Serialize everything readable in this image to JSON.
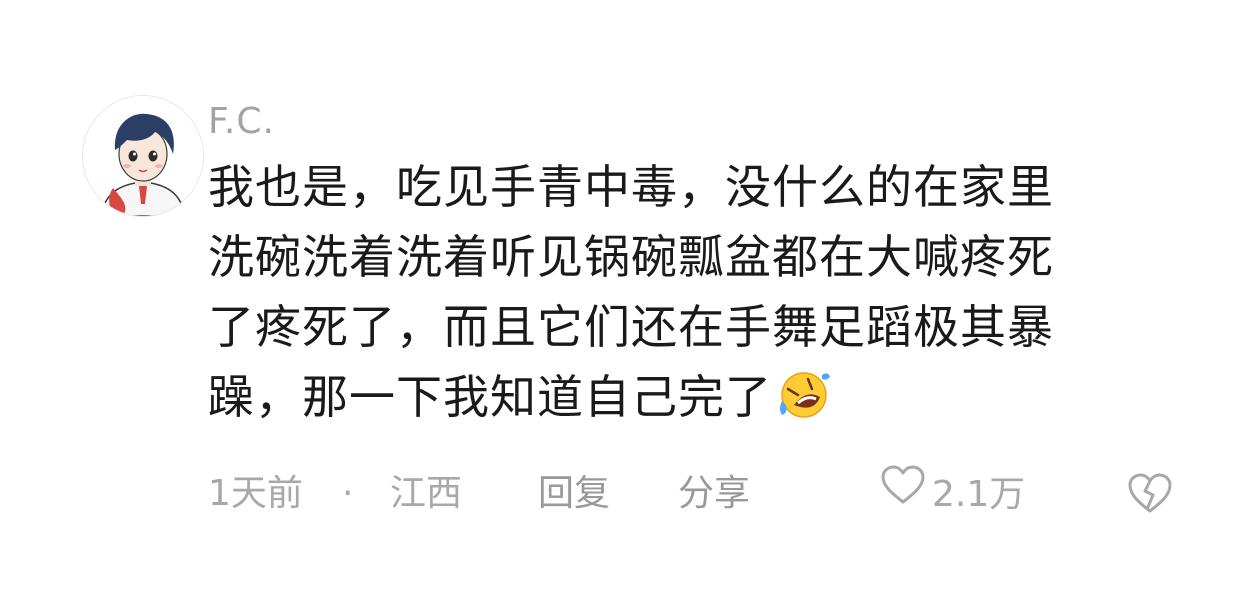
{
  "comment": {
    "username": "F.C.",
    "text_lines": [
      "我也是，吃见手青中毒，没什么的在家里",
      "洗碗洗着洗着听见锅碗瓢盆都在大喊疼死",
      "了疼死了，而且它们还在手舞足蹈极其暴",
      "躁，那一下我知道自己完了"
    ],
    "emoji": "rolling-on-floor-laughing-emoji",
    "time": "1天前",
    "separator": "·",
    "location": "江西",
    "reply_label": "回复",
    "share_label": "分享",
    "like_count": "2.1万",
    "icons": {
      "like": "heart-outline-icon",
      "dislike": "broken-heart-icon"
    }
  }
}
